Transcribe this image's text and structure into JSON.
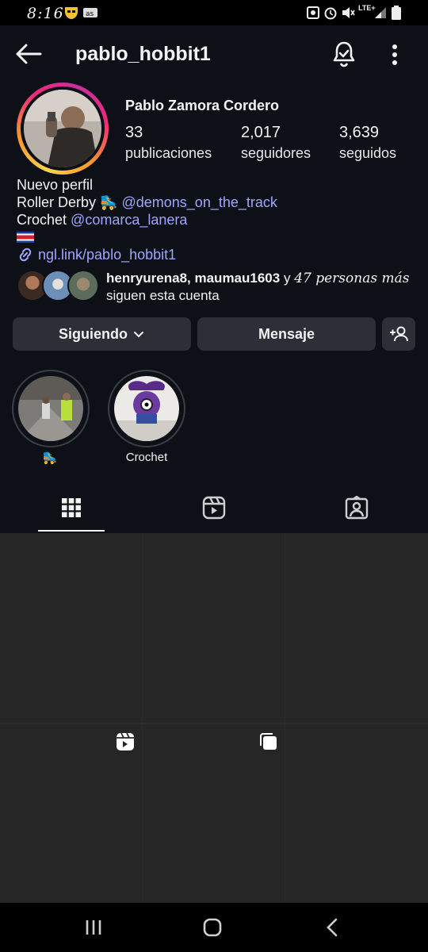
{
  "status_bar": {
    "time": "8:16",
    "network": "LTE+"
  },
  "header": {
    "username": "pablo_hobbit1",
    "back_icon": "arrow-left-icon",
    "bell_icon": "bell-icon",
    "more_icon": "more-vertical-icon"
  },
  "profile": {
    "full_name": "Pablo Zamora Cordero",
    "stats": [
      {
        "value": "33",
        "label": "publicaciones"
      },
      {
        "value": "2,017",
        "label": "seguidores"
      },
      {
        "value": "3,639",
        "label": "seguidos"
      }
    ],
    "bio": {
      "line1": "Nuevo perfil",
      "line2_text": "Roller Derby",
      "line2_emoji": "🛼",
      "line2_mention": "@demons_on_the_track",
      "line3_text": "Crochet",
      "line3_mention": "@comarca_lanera",
      "flag_icon": "costa-rica-flag-icon"
    },
    "link": "ngl.link/pablo_hobbit1",
    "followed_by": {
      "names": "henryurena8, maumau1603",
      "connector": "y",
      "others": "47 personas más",
      "suffix": "siguen esta cuenta"
    }
  },
  "actions": {
    "following_label": "Siguiendo",
    "message_label": "Mensaje",
    "add_user_icon": "add-user-icon"
  },
  "highlights": [
    {
      "label": "🛼"
    },
    {
      "label": "Crochet"
    }
  ],
  "tabs": [
    "grid-icon",
    "reels-icon",
    "tagged-icon"
  ],
  "grid_badges": [
    "reel-icon",
    "carousel-icon"
  ],
  "colors": {
    "background": "#0d1117",
    "mention": "#a1a5ff",
    "button": "#2c3036"
  }
}
